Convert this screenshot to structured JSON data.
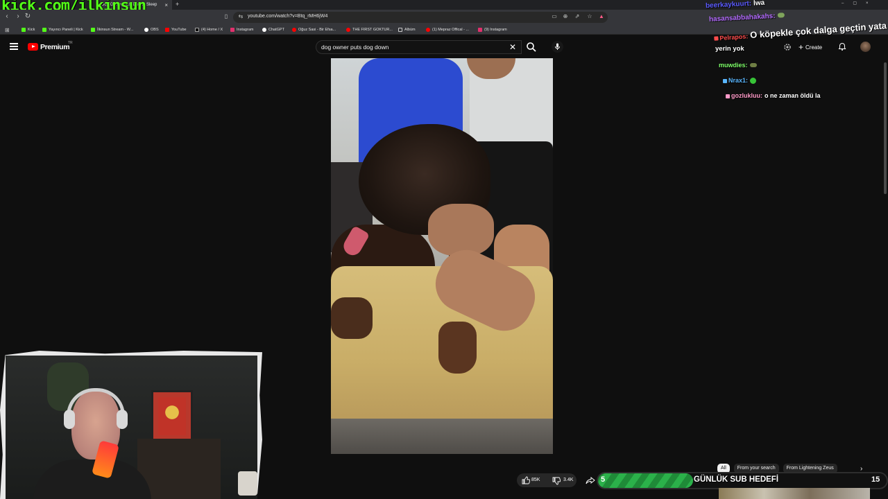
{
  "overlay": {
    "kick_url": "kick.com/ilkinsun",
    "goal": {
      "current": "5",
      "target": "15",
      "title": "GÜNLÜK SUB HEDEFİ",
      "progress": 0.33
    }
  },
  "browser": {
    "tabs": [
      {
        "label": ""
      },
      {
        "label": "Dog Owner Puts Dog to Sleep"
      }
    ],
    "url": "youtube.com/watch?v=Btq_rMH6jW4",
    "bookmarks": [
      "Kick",
      "Yayıncı Paneli | Kick",
      "İlkinsun Stream - W...",
      "OBS",
      "YouTube",
      "(4) Home / X",
      "Instagram",
      "ChatGPT",
      "Oğuz Sasi - Bir Efsa...",
      "THE FIRST GOKTUR...",
      "Albüm",
      "(1) Mepraz Offical - ...",
      "(9) Instagram"
    ]
  },
  "youtube": {
    "wordmark": "Premium",
    "region": "TR",
    "search_query": "dog owner puts dog down",
    "create_label": "Create",
    "chips": [
      "All",
      "From your search",
      "From Lightening Zeus"
    ],
    "likes": "85K",
    "dislikes": "3.4K"
  },
  "chat": [
    {
      "user": "beerkaykuurt:",
      "message": "lwa",
      "color": "#5b5bff"
    },
    {
      "user": "hasansabbahakahs:",
      "message": "",
      "color": "#b46cff"
    },
    {
      "user": "Pelrapos:",
      "message": "O köpekle çok dalga geçtin yata",
      "color": "#ff4c4c"
    },
    {
      "user": "",
      "message": "yerin yok",
      "color": "#ffffff"
    },
    {
      "user": "muwdies:",
      "message": "",
      "color": "#7fff6a"
    },
    {
      "user": "Nrax1:",
      "message": "",
      "color": "#5ab7ff"
    },
    {
      "user": "gozlukluu:",
      "message": "o ne zaman öldü la",
      "color": "#ff9ac8"
    }
  ],
  "colors": {
    "kick_green": "#53fc18",
    "yt_red": "#ff0000",
    "goal_green": "#2bb14a"
  }
}
